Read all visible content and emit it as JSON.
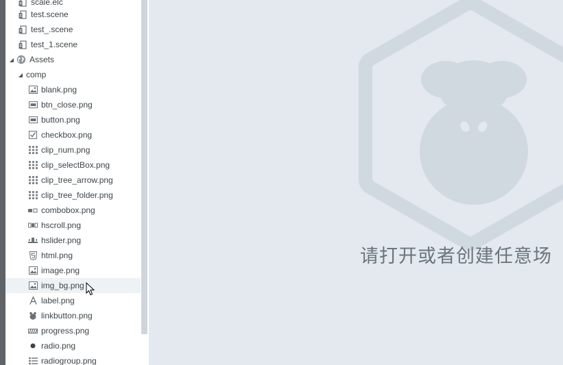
{
  "tree": {
    "items": [
      {
        "label": "scale.elc",
        "icon": "scene-file-icon"
      },
      {
        "label": "test.scene",
        "icon": "scene-file-icon"
      },
      {
        "label": "test_.scene",
        "icon": "scene-file-icon"
      },
      {
        "label": "test_1.scene",
        "icon": "scene-file-icon"
      },
      {
        "label": "Assets",
        "icon": "globe-icon"
      },
      {
        "label": "comp",
        "icon": "folder"
      },
      {
        "label": "blank.png",
        "icon": "image-icon"
      },
      {
        "label": "btn_close.png",
        "icon": "button-icon"
      },
      {
        "label": "button.png",
        "icon": "button-icon"
      },
      {
        "label": "checkbox.png",
        "icon": "checkbox-icon"
      },
      {
        "label": "clip_num.png",
        "icon": "clip-grid-icon"
      },
      {
        "label": "clip_selectBox.png",
        "icon": "clip-grid-icon"
      },
      {
        "label": "clip_tree_arrow.png",
        "icon": "clip-grid-icon"
      },
      {
        "label": "clip_tree_folder.png",
        "icon": "clip-grid-icon"
      },
      {
        "label": "combobox.png",
        "icon": "combobox-icon"
      },
      {
        "label": "hscroll.png",
        "icon": "hscroll-icon"
      },
      {
        "label": "hslider.png",
        "icon": "hslider-icon"
      },
      {
        "label": "html.png",
        "icon": "html5-icon"
      },
      {
        "label": "image.png",
        "icon": "image-icon"
      },
      {
        "label": "img_bg.png",
        "icon": "image-icon"
      },
      {
        "label": "label.png",
        "icon": "label-a-icon"
      },
      {
        "label": "linkbutton.png",
        "icon": "linkbutton-icon"
      },
      {
        "label": "progress.png",
        "icon": "progress-icon"
      },
      {
        "label": "radio.png",
        "icon": "radio-icon"
      },
      {
        "label": "radiogroup.png",
        "icon": "radiogroup-icon"
      }
    ]
  },
  "main": {
    "empty_message": "请打开或者创建任意场"
  },
  "colors": {
    "tree_bg": "#ffffff",
    "panel_bg": "#e3e9ee",
    "logo_fill": "#d0d9df",
    "text": "#3d4449"
  }
}
